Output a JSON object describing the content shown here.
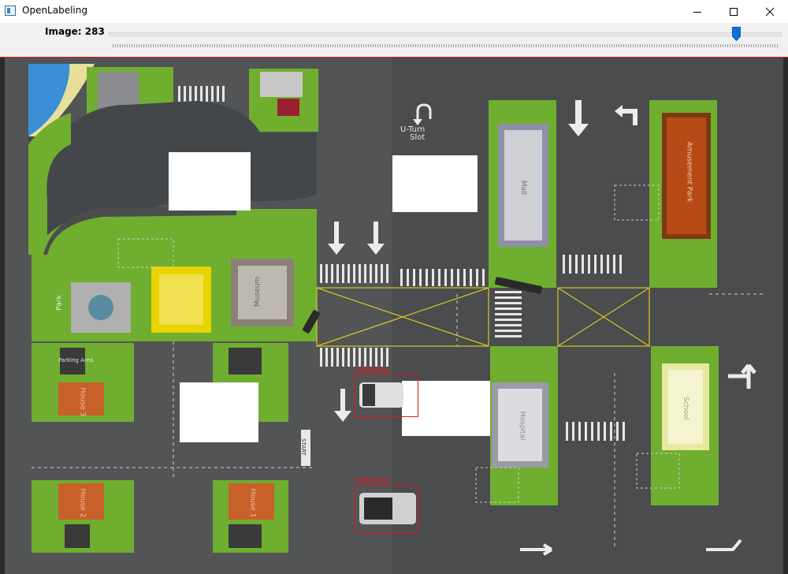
{
  "window": {
    "title": "OpenLabeling"
  },
  "trackbar": {
    "label": "Image: 283",
    "position_fraction": 0.935
  },
  "annotations": [
    {
      "label": "sidebay"
    },
    {
      "label": "sidebay"
    }
  ],
  "map_labels": {
    "u_turn": "U-Turn",
    "slot": "Slot",
    "mall": "Mall",
    "amusement_park": "Amusement Park",
    "museum": "Museum",
    "school": "School",
    "hospital": "Hospital",
    "park": "Park",
    "house_1": "House 1",
    "house_2": "House 2",
    "house_3": "House 3",
    "parking_area": "Parking Area",
    "start": "START"
  },
  "colors": {
    "bbox": "#e01818",
    "grass": "#6fae2f",
    "road": "#4a4c4e",
    "slider_thumb": "#0b6fd6"
  }
}
